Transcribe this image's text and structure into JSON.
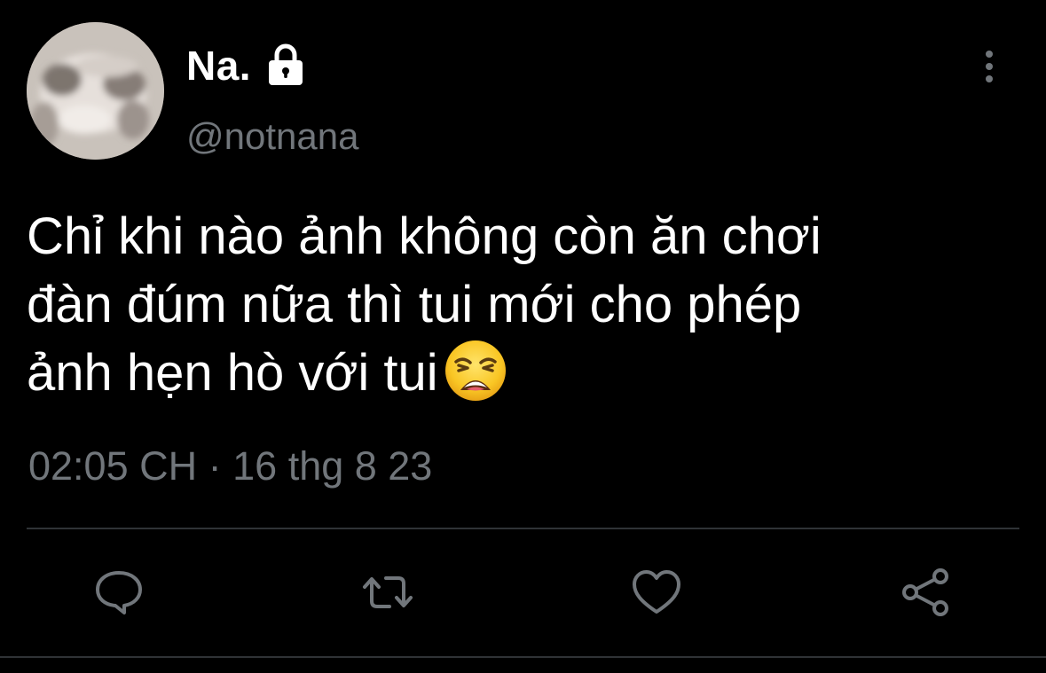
{
  "author": {
    "display_name": "Na.",
    "handle": "@notnana",
    "protected": true,
    "avatar_icon": "cat-photo-avatar"
  },
  "tweet": {
    "text_line1": "Chỉ khi nào ảnh không còn ăn chơi",
    "text_line2": "đàn đúm nữa thì tui mới cho phép",
    "text_line3": "ảnh hẹn hò với tui",
    "emoji": "weary-face-emoji",
    "time": "02:05 CH",
    "separator": "·",
    "date": "16 thg 8 23"
  },
  "actions": {
    "reply_icon": "reply-icon",
    "retweet_icon": "retweet-icon",
    "like_icon": "heart-icon",
    "share_icon": "share-icon",
    "icon_color": "#71767b"
  },
  "menu": {
    "more_icon": "more-vertical-icon"
  },
  "colors": {
    "background": "#000000",
    "text_primary": "#ffffff",
    "text_secondary": "#71767b",
    "divider": "#2f3336"
  }
}
